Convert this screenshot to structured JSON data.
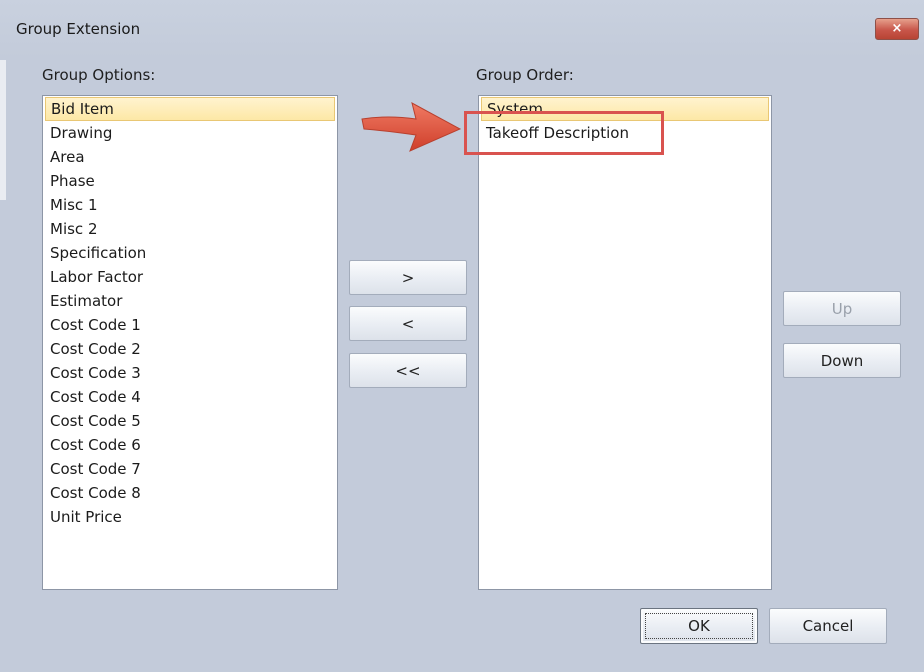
{
  "window": {
    "title": "Group Extension",
    "close_symbol": "×"
  },
  "group_options": {
    "label": "Group Options:",
    "items": [
      "Bid Item",
      "Drawing",
      "Area",
      "Phase",
      "Misc 1",
      "Misc 2",
      "Specification",
      "Labor Factor",
      "Estimator",
      "Cost Code 1",
      "Cost Code 2",
      "Cost Code 3",
      "Cost Code 4",
      "Cost Code 5",
      "Cost Code 6",
      "Cost Code 7",
      "Cost Code 8",
      "Unit Price"
    ],
    "selected": "Bid Item"
  },
  "group_order": {
    "label": "Group Order:",
    "items": [
      "System",
      "Takeoff Description"
    ],
    "selected": "System"
  },
  "transfer_buttons": {
    "add": ">",
    "remove": "<",
    "remove_all": "<<"
  },
  "order_buttons": {
    "up": "Up",
    "down": "Down"
  },
  "dialog_buttons": {
    "ok": "OK",
    "cancel": "Cancel"
  },
  "annotation": {
    "color": "#d9534f",
    "arrow_color": "#e0503c"
  }
}
